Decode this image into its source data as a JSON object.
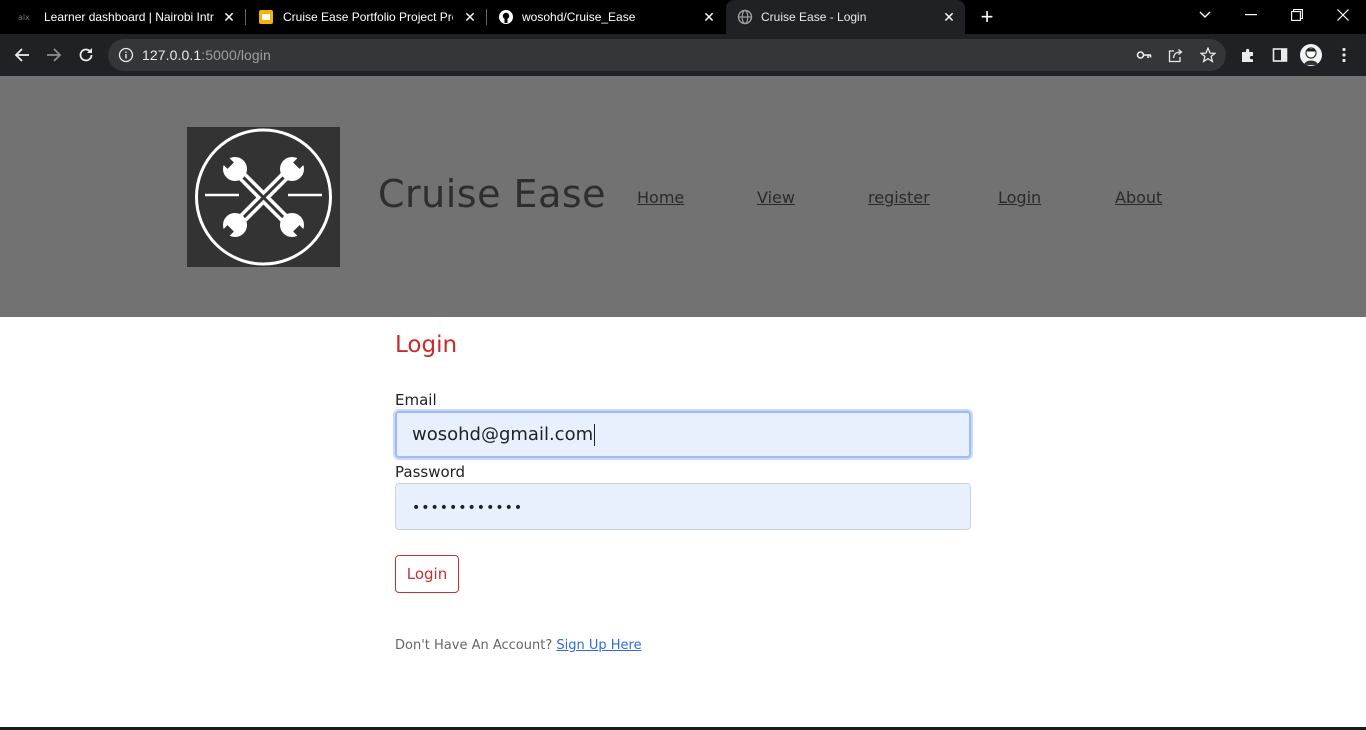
{
  "browser": {
    "tabs": [
      {
        "title": "Learner dashboard | Nairobi Intr",
        "favicon": "alx-icon",
        "active": false
      },
      {
        "title": "Cruise Ease Portfolio Project Pre",
        "favicon": "slides-icon",
        "active": false
      },
      {
        "title": "wosohd/Cruise_Ease",
        "favicon": "github-icon",
        "active": false
      },
      {
        "title": "Cruise Ease - Login",
        "favicon": "globe-icon",
        "active": true
      }
    ],
    "url_host": "127.0.0.1",
    "url_path": ":5000/login",
    "colors": {
      "tabstrip": "#000000",
      "toolbar": "#202124",
      "omnibox": "#35363a"
    }
  },
  "site": {
    "brand": "Cruise Ease",
    "nav": [
      "Home",
      "View",
      "register",
      "Login",
      "About"
    ],
    "colors": {
      "header_bg": "#727272",
      "logo_bg": "#333333",
      "accent": "#c53030"
    }
  },
  "login": {
    "heading": "Login",
    "email_label": "Email",
    "email_value": "wosohd@gmail.com",
    "password_label": "Password",
    "password_value": "••••••••••••",
    "submit_label": "Login",
    "signup_prompt": "Don't Have An Account?",
    "signup_link": "Sign Up Here"
  }
}
